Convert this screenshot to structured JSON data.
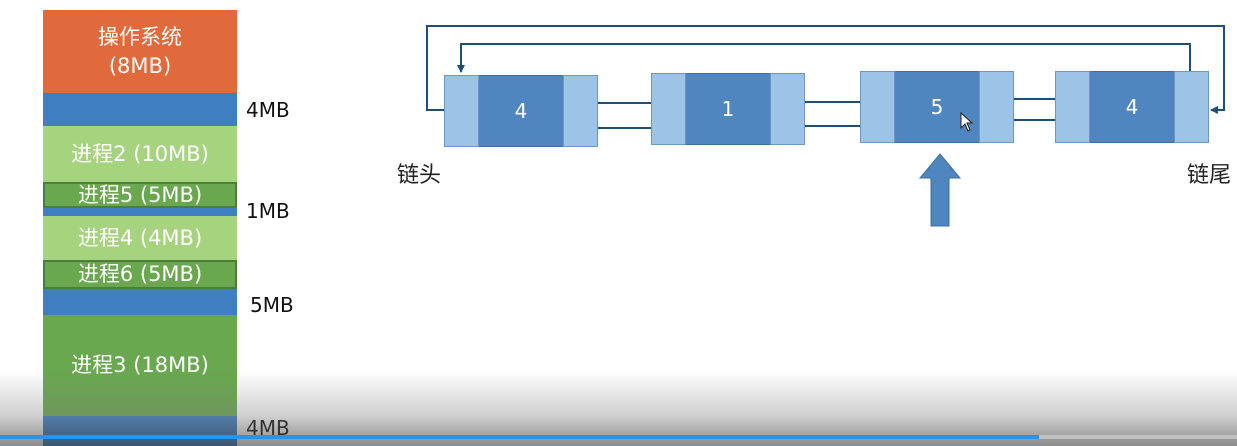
{
  "memory": {
    "os_label": "操作系统\n(8MB)",
    "process2": "进程2 (10MB)",
    "process5": "进程5 (5MB)",
    "process4": "进程4 (4MB)",
    "process6": "进程6 (5MB)",
    "process3": "进程3 (18MB)",
    "free_sizes": [
      "4MB",
      "1MB",
      "5MB",
      "4MB"
    ]
  },
  "linked_list": {
    "nodes": [
      "4",
      "1",
      "5",
      "4"
    ],
    "head_label": "链头",
    "tail_label": "链尾"
  },
  "colors": {
    "os": "#e06a3c",
    "free": "#3f7fc1",
    "process_light": "#a6d47e",
    "process_dark": "#6aa84f",
    "node_value": "#4f86c0",
    "node_pointer": "#9dc3e6",
    "arrow": "#1f4e79",
    "progress": "#2196f3"
  },
  "video": {
    "progress_fraction": 0.84
  }
}
